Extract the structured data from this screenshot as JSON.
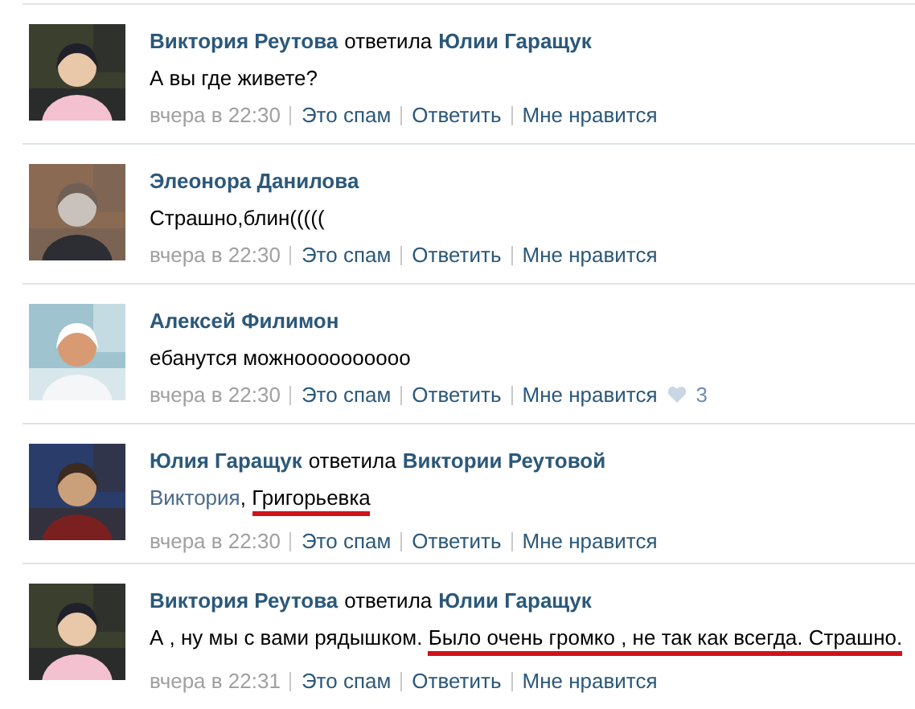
{
  "comments": [
    {
      "author": "Виктория Реутова",
      "verb": "ответила",
      "reply_to": "Юлии Гаращук",
      "text": [
        {
          "kind": "plain",
          "text": "А вы где живете?",
          "underlined": false
        }
      ],
      "time": "вчера в 22:30",
      "actions": [
        "Это спам",
        "Ответить",
        "Мне нравится"
      ],
      "avatar": {
        "kind": "picture"
      }
    },
    {
      "author": "Элеонора Данилова",
      "text": [
        {
          "kind": "plain",
          "text": "Страшно,блин(((((",
          "underlined": false
        }
      ],
      "time": "вчера в 22:30",
      "actions": [
        "Это спам",
        "Ответить",
        "Мне нравится"
      ],
      "avatar": {
        "kind": "picture"
      }
    },
    {
      "author": "Алексей Филимон",
      "text": [
        {
          "kind": "plain",
          "text": "ебанутся можноооооооооо",
          "underlined": false
        }
      ],
      "time": "вчера в 22:30",
      "actions": [
        "Это спам",
        "Ответить",
        "Мне нравится"
      ],
      "likes": "3",
      "avatar": {
        "kind": "picture"
      }
    },
    {
      "author": "Юлия Гаращук",
      "verb": "ответила",
      "reply_to": "Виктории Реутовой",
      "text": [
        {
          "kind": "link",
          "text": "Виктория",
          "underlined": false
        },
        {
          "kind": "plain",
          "text": ", ",
          "underlined": false
        },
        {
          "kind": "plain",
          "text": "Григорьевка",
          "underlined": true
        }
      ],
      "time": "вчера в 22:30",
      "actions": [
        "Это спам",
        "Ответить",
        "Мне нравится"
      ],
      "avatar": {
        "kind": "picture"
      }
    },
    {
      "author": "Виктория Реутова",
      "verb": "ответила",
      "reply_to": "Юлии Гаращук",
      "text": [
        {
          "kind": "plain",
          "text": "А , ну мы с вами рядышком. ",
          "underlined": false
        },
        {
          "kind": "plain",
          "text": "Было очень громко , не так как всегда. Страшно.",
          "underlined": true
        }
      ],
      "time": "вчера в 22:31",
      "actions": [
        "Это спам",
        "Ответить",
        "Мне нравится"
      ],
      "avatar": {
        "kind": "picture"
      }
    }
  ]
}
